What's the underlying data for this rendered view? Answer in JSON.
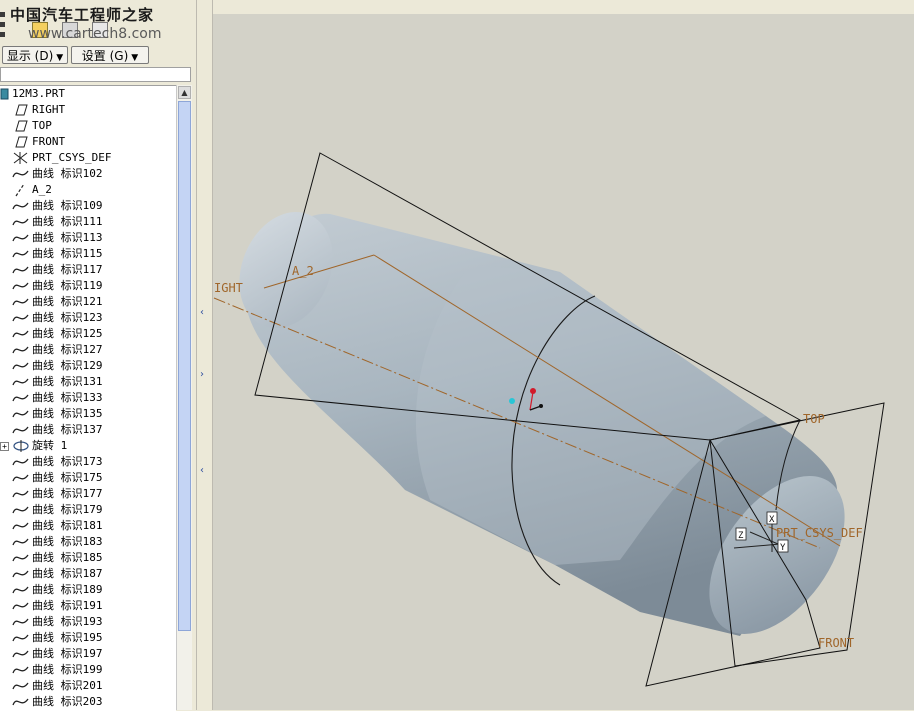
{
  "watermark": {
    "title": "中国汽车工程师之家",
    "url": "www.cartech8.com"
  },
  "toolbar": {
    "show_label": "显示 (D)",
    "settings_label": "设置 (G)"
  },
  "tree": {
    "root": "12M3.PRT",
    "items": [
      {
        "icon": "datum-plane-icon",
        "label": "RIGHT"
      },
      {
        "icon": "datum-plane-icon",
        "label": "TOP"
      },
      {
        "icon": "datum-plane-icon",
        "label": "FRONT"
      },
      {
        "icon": "coordinate-system-icon",
        "label": "PRT_CSYS_DEF"
      },
      {
        "icon": "curve-icon",
        "label": "曲线 标识102"
      },
      {
        "icon": "datum-axis-icon",
        "label": "A_2"
      },
      {
        "icon": "curve-icon",
        "label": "曲线 标识109"
      },
      {
        "icon": "curve-icon",
        "label": "曲线 标识111"
      },
      {
        "icon": "curve-icon",
        "label": "曲线 标识113"
      },
      {
        "icon": "curve-icon",
        "label": "曲线 标识115"
      },
      {
        "icon": "curve-icon",
        "label": "曲线 标识117"
      },
      {
        "icon": "curve-icon",
        "label": "曲线 标识119"
      },
      {
        "icon": "curve-icon",
        "label": "曲线 标识121"
      },
      {
        "icon": "curve-icon",
        "label": "曲线 标识123"
      },
      {
        "icon": "curve-icon",
        "label": "曲线 标识125"
      },
      {
        "icon": "curve-icon",
        "label": "曲线 标识127"
      },
      {
        "icon": "curve-icon",
        "label": "曲线 标识129"
      },
      {
        "icon": "curve-icon",
        "label": "曲线 标识131"
      },
      {
        "icon": "curve-icon",
        "label": "曲线 标识133"
      },
      {
        "icon": "curve-icon",
        "label": "曲线 标识135"
      },
      {
        "icon": "curve-icon",
        "label": "曲线 标识137"
      },
      {
        "icon": "revolve-icon",
        "label": "旋转 1",
        "expandable": true
      },
      {
        "icon": "curve-icon",
        "label": "曲线 标识173"
      },
      {
        "icon": "curve-icon",
        "label": "曲线 标识175"
      },
      {
        "icon": "curve-icon",
        "label": "曲线 标识177"
      },
      {
        "icon": "curve-icon",
        "label": "曲线 标识179"
      },
      {
        "icon": "curve-icon",
        "label": "曲线 标识181"
      },
      {
        "icon": "curve-icon",
        "label": "曲线 标识183"
      },
      {
        "icon": "curve-icon",
        "label": "曲线 标识185"
      },
      {
        "icon": "curve-icon",
        "label": "曲线 标识187"
      },
      {
        "icon": "curve-icon",
        "label": "曲线 标识189"
      },
      {
        "icon": "curve-icon",
        "label": "曲线 标识191"
      },
      {
        "icon": "curve-icon",
        "label": "曲线 标识193"
      },
      {
        "icon": "curve-icon",
        "label": "曲线 标识195"
      },
      {
        "icon": "curve-icon",
        "label": "曲线 标识197"
      },
      {
        "icon": "curve-icon",
        "label": "曲线 标识199"
      },
      {
        "icon": "curve-icon",
        "label": "曲线 标识201"
      },
      {
        "icon": "curve-icon",
        "label": "曲线 标识203"
      }
    ]
  },
  "viewport": {
    "labels": {
      "right": "IGHT",
      "axis": "A_2",
      "top": "TOP",
      "csys": "PRT_CSYS_DEF",
      "front": "FRONT",
      "csys_z": "Z",
      "csys_x": "X",
      "csys_y": "Y"
    },
    "colors": {
      "background": "#d3d2c8",
      "datum_label": "#a0662a",
      "part": "#a7b4be"
    }
  }
}
